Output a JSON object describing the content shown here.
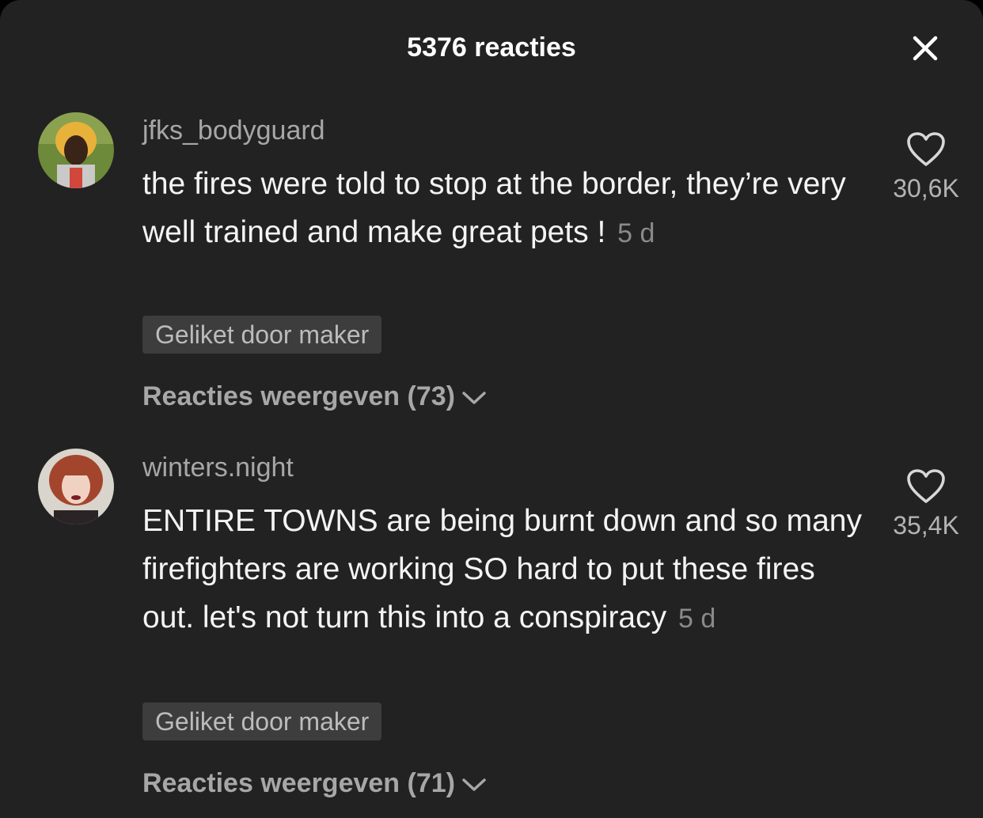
{
  "header": {
    "title": "5376 reacties",
    "close_icon": "close-icon"
  },
  "comments": [
    {
      "username": "jfks_bodyguard",
      "text": "the fires were told to stop at the border, they’re very well trained and make great pets !",
      "age": "5 d",
      "badge": "Geliket door maker",
      "replies_label": "Reacties weergeven (73)",
      "likes": "30,6K",
      "avatar_colors": {
        "bg": "#6c8a3a",
        "hair": "#e8b13a",
        "skin": "#3a2418"
      }
    },
    {
      "username": "winters.night",
      "text": "ENTIRE TOWNS are being burnt down and so many firefighters are working SO hard to put these fires out. let's not turn this into a conspiracy",
      "age": "5 d",
      "badge": "Geliket door maker",
      "replies_label": "Reacties weergeven (71)",
      "likes": "35,4K",
      "avatar_colors": {
        "bg": "#d9d4cc",
        "hair": "#a3452c",
        "skin": "#f1d2c2"
      }
    }
  ],
  "colors": {
    "background": "#222222",
    "text": "#f4f4f4",
    "muted": "#a7a7a7",
    "badge_bg": "#3d3d3d"
  }
}
